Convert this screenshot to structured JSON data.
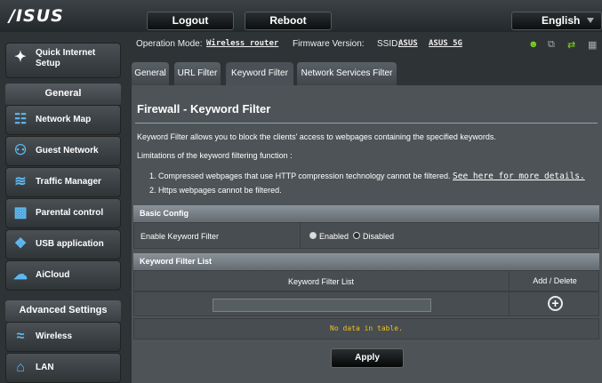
{
  "header": {
    "logo": "/ISUS",
    "logout_label": "Logout",
    "reboot_label": "Reboot",
    "language": "English"
  },
  "status": {
    "op_mode_label": "Operation Mode:",
    "op_mode_value": "Wireless router",
    "firmware_label": "Firmware Version:",
    "ssid_label": "SSID:",
    "ssid_1": "ASUS",
    "ssid_2": "ASUS_5G",
    "icons": [
      "user-icon",
      "network-icon",
      "usb-icon",
      "printer-icon"
    ]
  },
  "sidebar": {
    "quick_setup": "Quick Internet Setup",
    "general_heading": "General",
    "general_items": [
      {
        "label": "Network Map",
        "icon": "network-map-icon"
      },
      {
        "label": "Guest Network",
        "icon": "guest-network-icon"
      },
      {
        "label": "Traffic Manager",
        "icon": "traffic-manager-icon"
      },
      {
        "label": "Parental control",
        "icon": "lock-icon"
      },
      {
        "label": "USB application",
        "icon": "puzzle-icon"
      },
      {
        "label": "AiCloud",
        "icon": "cloud-icon"
      }
    ],
    "advanced_heading": "Advanced Settings",
    "advanced_items": [
      {
        "label": "Wireless",
        "icon": "wifi-icon"
      },
      {
        "label": "LAN",
        "icon": "home-icon"
      }
    ]
  },
  "tabs": [
    {
      "label": "General"
    },
    {
      "label": "URL Filter"
    },
    {
      "label": "Keyword Filter",
      "active": true
    },
    {
      "label": "Network Services Filter"
    }
  ],
  "page": {
    "title": "Firewall - Keyword Filter",
    "description": "Keyword Filter allows you to block the clients' access to webpages containing the specified keywords.",
    "limitations_label": "Limitations of the keyword filtering function :",
    "limitation_1": "1.  Compressed webpages that use HTTP compression technology cannot be filtered. ",
    "limitation_1_link": "See here for more details.",
    "limitation_2": "2.  Https webpages cannot be filtered."
  },
  "basic_config": {
    "heading": "Basic Config",
    "enable_label": "Enable Keyword Filter",
    "option_enabled": "Enabled",
    "option_disabled": "Disabled",
    "selected": "Disabled"
  },
  "keyword_list": {
    "heading": "Keyword Filter List",
    "col_keyword": "Keyword Filter List",
    "col_add_delete": "Add / Delete",
    "input_value": "",
    "empty_text": "No data in table."
  },
  "apply_label": "Apply"
}
